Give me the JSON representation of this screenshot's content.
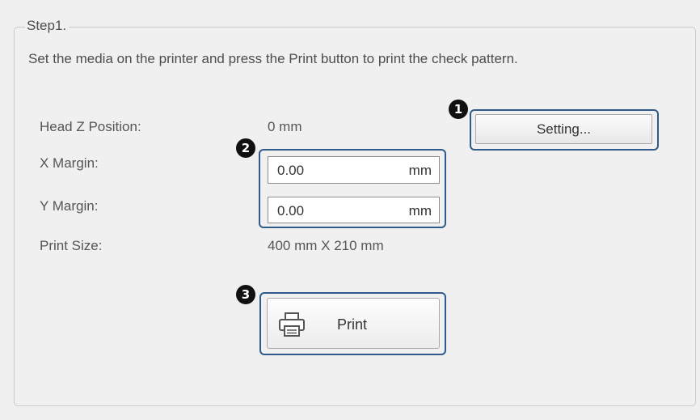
{
  "step": {
    "title": "Step1.",
    "instruction": "Set the media on the printer and press the Print button to print the check pattern."
  },
  "fields": {
    "head_z": {
      "label": "Head Z Position:",
      "value": "0 mm"
    },
    "x_margin": {
      "label": "X Margin:",
      "value": "0.00",
      "unit": "mm"
    },
    "y_margin": {
      "label": "Y Margin:",
      "value": "0.00",
      "unit": "mm"
    },
    "print_size": {
      "label": "Print Size:",
      "value": "400 mm X 210 mm"
    }
  },
  "buttons": {
    "setting": "Setting...",
    "print": "Print",
    "print_icon": "printer-icon"
  },
  "callouts": [
    "1",
    "2",
    "3"
  ],
  "colors": {
    "highlight": "#2f5b8a",
    "callout_badge": "#111111",
    "panel_background": "#f0f0f0"
  }
}
